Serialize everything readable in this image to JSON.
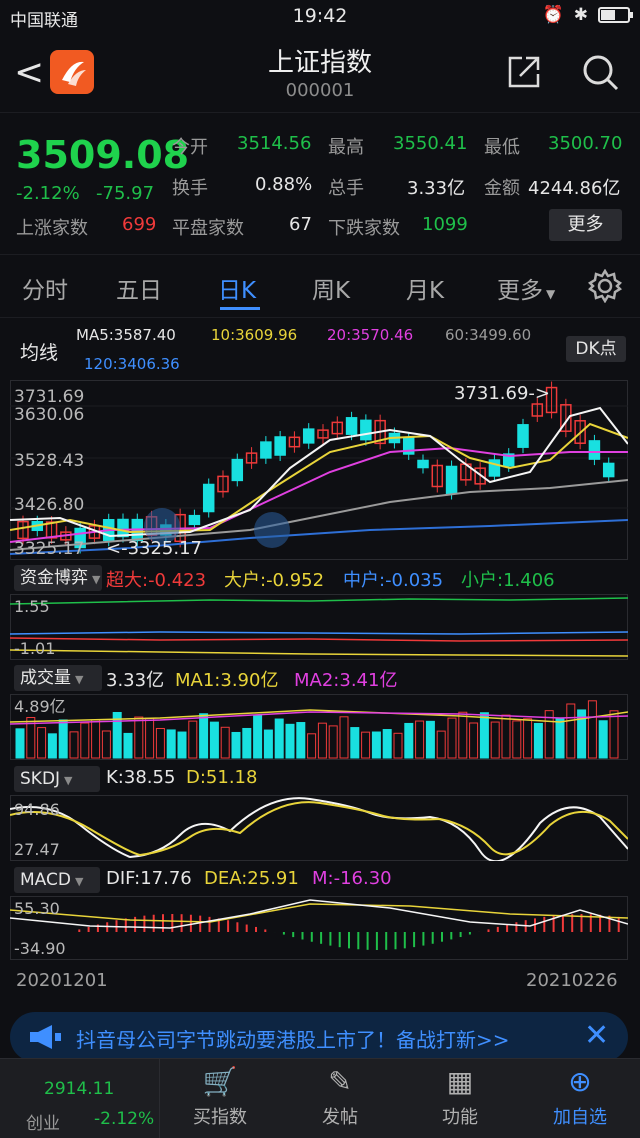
{
  "status": {
    "carrier": "中国联通",
    "time": "19:42",
    "battery_pct": 0.55
  },
  "header": {
    "title": "上证指数",
    "code": "000001"
  },
  "quote": {
    "price": "3509.08",
    "pct": "-2.12%",
    "change": "-75.97",
    "rows": [
      [
        {
          "label": "今开",
          "value": "3514.56",
          "color": "#1fbf4a"
        },
        {
          "label": "最高",
          "value": "3550.41",
          "color": "#1fbf4a"
        },
        {
          "label": "最低",
          "value": "3500.70",
          "color": "#1fbf4a"
        }
      ],
      [
        {
          "label": "换手",
          "value": "0.88%",
          "color": "#e6e6e6"
        },
        {
          "label": "总手",
          "value": "3.33亿",
          "color": "#e6e6e6"
        },
        {
          "label": "金额",
          "value": "4244.86亿",
          "color": "#e6e6e6"
        }
      ]
    ],
    "up_label": "上涨家数",
    "up_value": "699",
    "flat_label": "平盘家数",
    "flat_value": "67",
    "down_label": "下跌家数",
    "down_value": "1099",
    "more_label": "更多"
  },
  "tabs": [
    "分时",
    "五日",
    "日K",
    "周K",
    "月K",
    "更多"
  ],
  "active_tab": 2,
  "ma_legend": {
    "title": "均线",
    "ma5": "MA5:3587.40",
    "ma10": "10:3609.96",
    "ma20": "20:3570.46",
    "ma60": "60:3499.60",
    "ma120": "120:3406.36",
    "dk": "DK点"
  },
  "main_chart": {
    "y_labels": [
      "3731.69",
      "3630.06",
      "3528.43",
      "3426.80",
      "3325.17"
    ],
    "high_label": "3731.69->",
    "low_label": "<-3325.17"
  },
  "fund_panel": {
    "button": "资金博弈",
    "items": [
      {
        "text": "超大:-0.423",
        "color": "#f03a3a"
      },
      {
        "text": "大户:-0.952",
        "color": "#e8d43a"
      },
      {
        "text": "中户:-0.035",
        "color": "#3f8fff"
      },
      {
        "text": "小户:1.406",
        "color": "#1fbf4a"
      }
    ],
    "y_top": "1.55",
    "y_bottom": "-1.01"
  },
  "volume_panel": {
    "button": "成交量",
    "vol": "3.33亿",
    "ma1": "MA1:3.90亿",
    "ma2": "MA2:3.41亿",
    "y_top": "4.89亿"
  },
  "skdj_panel": {
    "button": "SKDJ",
    "k": "K:38.55",
    "d": "D:51.18",
    "y_top": "94.86",
    "y_bottom": "27.47"
  },
  "macd_panel": {
    "button": "MACD",
    "dif": "DIF:17.76",
    "dea": "DEA:25.91",
    "m": "M:-16.30",
    "y_top": "55.30",
    "y_bottom": "-34.90"
  },
  "dates": {
    "start": "20201201",
    "end": "20210226"
  },
  "banner": {
    "text": "抖音母公司字节跳动要港股上市了！备战打新>>"
  },
  "bottom": {
    "ticker_value": "2914.11",
    "ticker_name": "创业",
    "ticker_pct": "-2.12%",
    "items": [
      "买指数",
      "发帖",
      "功能",
      "加自选"
    ]
  }
}
